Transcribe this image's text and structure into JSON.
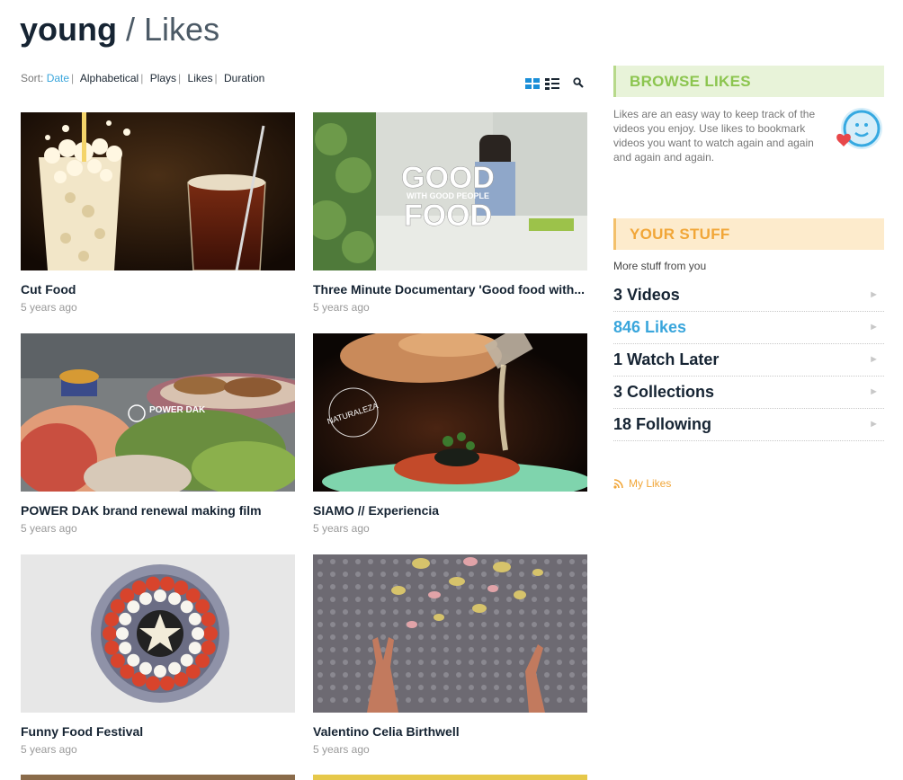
{
  "header": {
    "owner": "young",
    "separator": "/",
    "page": "Likes"
  },
  "sort": {
    "label": "Sort:",
    "options": [
      "Date",
      "Alphabetical",
      "Plays",
      "Likes",
      "Duration"
    ],
    "active": "Date"
  },
  "videos": [
    {
      "title": "Cut Food",
      "date": "5 years ago"
    },
    {
      "title": "Three Minute Documentary 'Good food with...",
      "date": "5 years ago"
    },
    {
      "title": "POWER DAK brand renewal making film",
      "date": "5 years ago"
    },
    {
      "title": "SIAMO // Experiencia",
      "date": "5 years ago"
    },
    {
      "title": "Funny Food Festival",
      "date": "5 years ago"
    },
    {
      "title": "Valentino Celia Birthwell",
      "date": "5 years ago"
    }
  ],
  "thumb_text": {
    "good_food_1": "GOOD",
    "good_food_sub": "WITH GOOD PEOPLE",
    "good_food_2": "FOOD",
    "power_dak": "POWER DAK",
    "naturaleza": "NATURALEZA"
  },
  "browse_likes": {
    "heading": "BROWSE LIKES",
    "description": "Likes are an easy way to keep track of the videos you enjoy. Use likes to bookmark videos you want to watch again and again and again and again."
  },
  "your_stuff": {
    "heading": "YOUR STUFF",
    "subtitle": "More stuff from you",
    "items": [
      {
        "label": "3 Videos"
      },
      {
        "label": "846 Likes"
      },
      {
        "label": "1 Watch Later"
      },
      {
        "label": "3 Collections"
      },
      {
        "label": "18 Following"
      }
    ],
    "arrow": "►",
    "rss_label": "My Likes"
  },
  "icons": [
    "grid-view-icon",
    "list-view-icon",
    "search-icon",
    "likes-face-heart-icon",
    "rss-icon",
    "chevron-right-icon"
  ],
  "colors": {
    "accent_blue": "#3aa6dc",
    "browse_green": "#8cc54f",
    "stuff_orange": "#f1a638"
  }
}
